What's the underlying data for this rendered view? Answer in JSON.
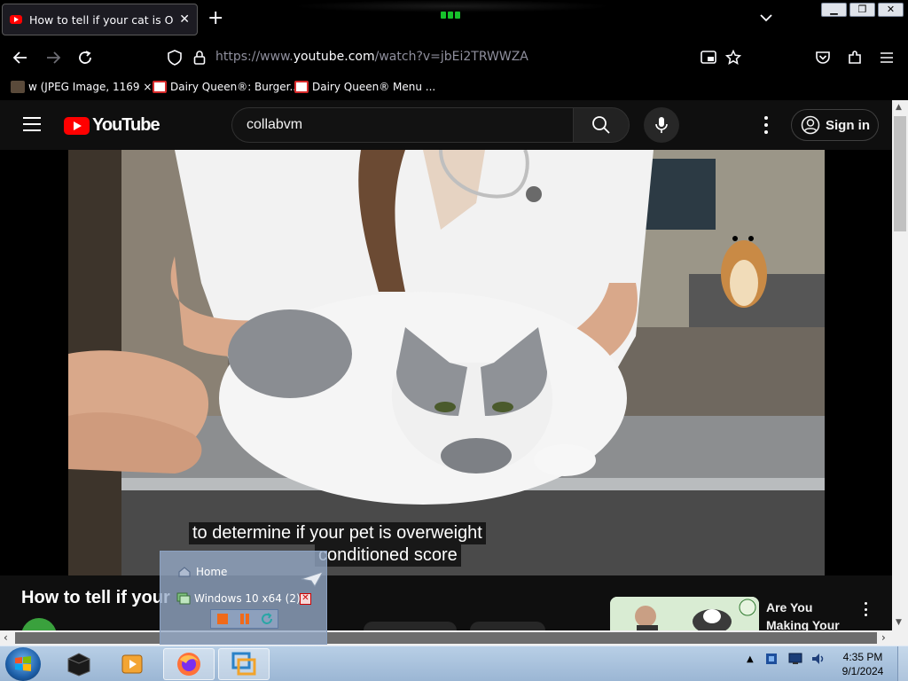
{
  "browser": {
    "tab": {
      "title": "How to tell if your cat is Obese"
    },
    "url": {
      "prefix": "https://www.",
      "host": "youtube.com",
      "path": "/watch?v=jbEi2TRWWZA"
    },
    "bookmarks": [
      {
        "label": "w (JPEG Image, 1169 ×...",
        "icon": "image-icon",
        "color": "#5a4a3a"
      },
      {
        "label": "Dairy Queen®: Burger...",
        "icon": "dairy-queen-icon",
        "color": "#d62b2b"
      },
      {
        "label": "Dairy Queen® Menu ...",
        "icon": "dairy-queen-icon",
        "color": "#d62b2b"
      }
    ]
  },
  "youtube": {
    "logo_text": "YouTube",
    "search_value": "collabvm",
    "signin_label": "Sign in",
    "video_title": "How to tell if your",
    "captions": [
      "to determine if your pet is overweight",
      "conditioned score"
    ],
    "recommended": {
      "title": "Are You Making Your Cat FAT?..."
    }
  },
  "popup": {
    "home_label": "Home",
    "vm_label": "Windows 10 x64 (2)"
  },
  "taskbar": {
    "time": "4:35 PM",
    "date": "9/1/2024"
  },
  "colors": {
    "yt_red": "#ff0000",
    "yt_bg": "#0f0f0f",
    "taskbar": "#a9c2dd"
  }
}
